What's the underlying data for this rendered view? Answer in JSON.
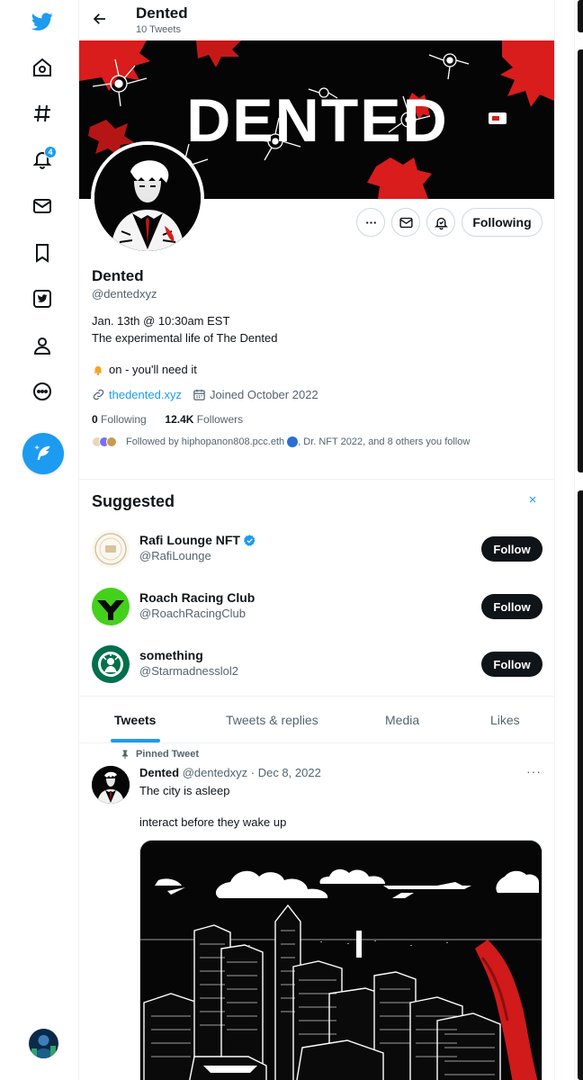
{
  "header": {
    "title": "Dented",
    "subtitle": "10 Tweets"
  },
  "nav": {
    "items": [
      {
        "name": "twitter-logo-icon"
      },
      {
        "name": "home-icon"
      },
      {
        "name": "explore-hashtag-icon"
      },
      {
        "name": "notifications-bell-icon",
        "badge": "4"
      },
      {
        "name": "messages-envelope-icon"
      },
      {
        "name": "bookmarks-icon"
      },
      {
        "name": "twitter-blue-icon"
      },
      {
        "name": "profile-person-icon"
      },
      {
        "name": "more-circle-icon"
      }
    ],
    "compose_icon": "compose-feather-icon"
  },
  "banner": {
    "text": "DENTED"
  },
  "profile": {
    "name": "Dented",
    "handle": "@dentedxyz",
    "bio_line1": "Jan. 13th @ 10:30am EST",
    "bio_line2": "The experimental life of The Dented",
    "bio_line3": "on - you'll need it",
    "website": "thedented.xyz",
    "joined": "Joined October 2022",
    "following_count": "0",
    "following_label": "Following",
    "followers_count": "12.4K",
    "followers_label": "Followers",
    "followed_by": "Followed by hiphopanon808.pcc.eth",
    "followed_by_rest": ", Dr. NFT 2022, and 8 others you follow"
  },
  "actions": {
    "following_button": "Following"
  },
  "suggested": {
    "title": "Suggested",
    "close": "×",
    "accounts": [
      {
        "name": "Rafi Lounge NFT",
        "handle": "@RafiLounge",
        "verified": true,
        "button": "Follow"
      },
      {
        "name": "Roach Racing Club",
        "handle": "@RoachRacingClub",
        "verified": false,
        "button": "Follow"
      },
      {
        "name": "something",
        "handle": "@Starmadnesslol2",
        "verified": false,
        "button": "Follow"
      }
    ]
  },
  "tabs": [
    {
      "label": "Tweets",
      "active": true
    },
    {
      "label": "Tweets & replies",
      "active": false
    },
    {
      "label": "Media",
      "active": false
    },
    {
      "label": "Likes",
      "active": false
    }
  ],
  "tweet": {
    "pinned_label": "Pinned Tweet",
    "author": "Dented",
    "meta": "@dentedxyz · Dec 8, 2022",
    "line1": "The city is asleep",
    "line2": "interact before they wake up",
    "more": "···"
  },
  "colors": {
    "accent": "#1d9bf0",
    "text": "#0f1419",
    "muted": "#536471",
    "banner_red": "#e0201c"
  }
}
